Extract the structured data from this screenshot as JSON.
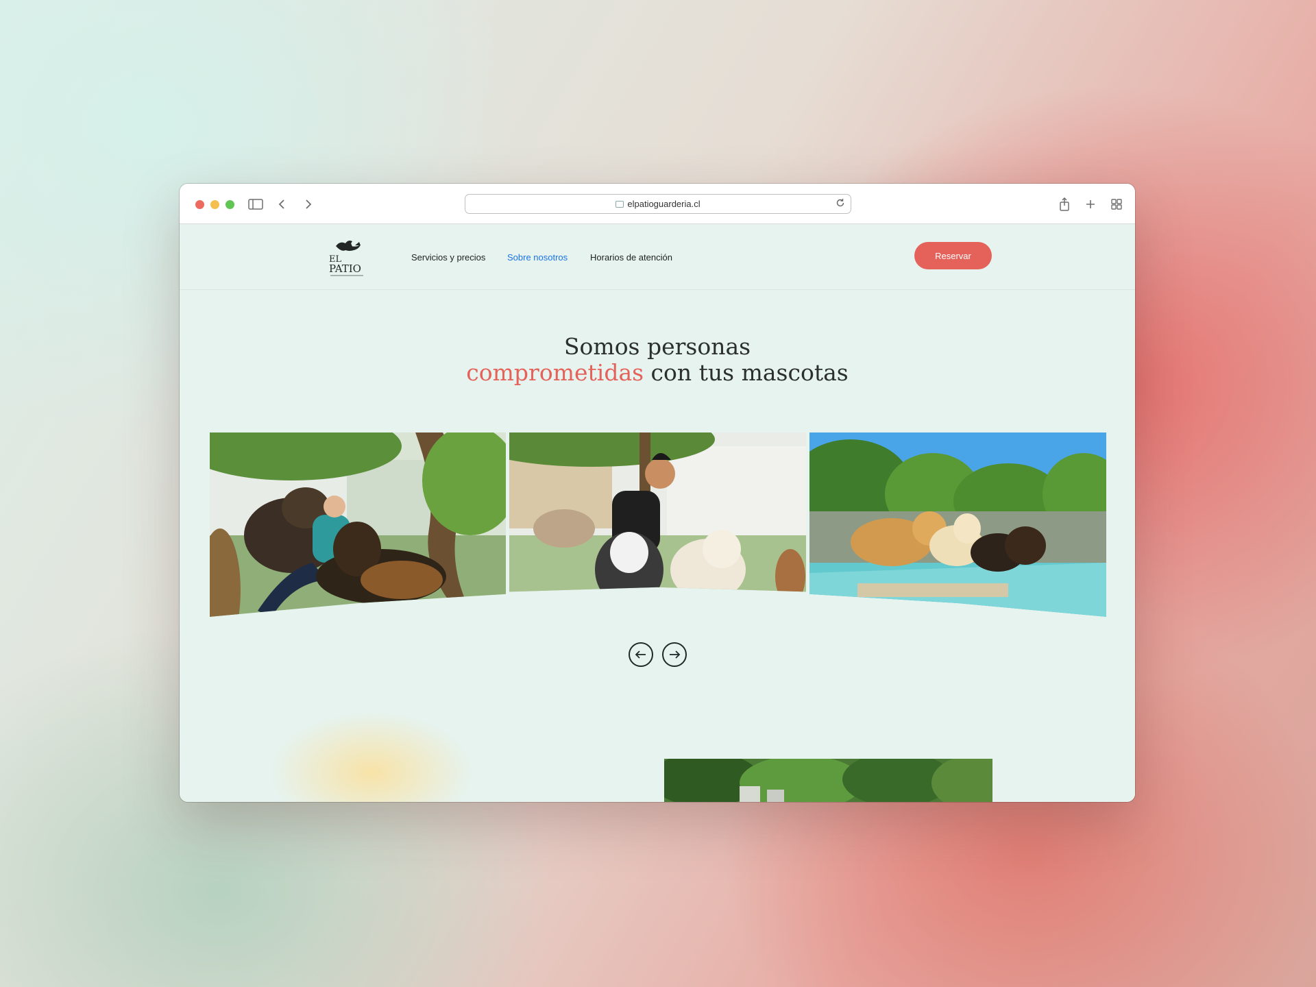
{
  "browser": {
    "url": "elpatioguarderia.cl"
  },
  "site": {
    "logo_text": "EL PATIO",
    "nav": [
      {
        "label": "Servicios y precios"
      },
      {
        "label": "Sobre nosotros"
      },
      {
        "label": "Horarios de atención"
      }
    ],
    "reserve_label": "Reservar",
    "headline_line1": "Somos personas",
    "headline_accent": "comprometidas",
    "headline_rest": " con tus mascotas"
  },
  "colors": {
    "accent": "#e4625a",
    "active_link": "#1a73e8",
    "page_bg": "#e6f3ef"
  },
  "icons": [
    "sidebar-icon",
    "back-icon",
    "forward-icon",
    "reload-icon",
    "share-icon",
    "new-tab-icon",
    "tab-overview-icon",
    "arrow-left-icon",
    "arrow-right-icon"
  ]
}
